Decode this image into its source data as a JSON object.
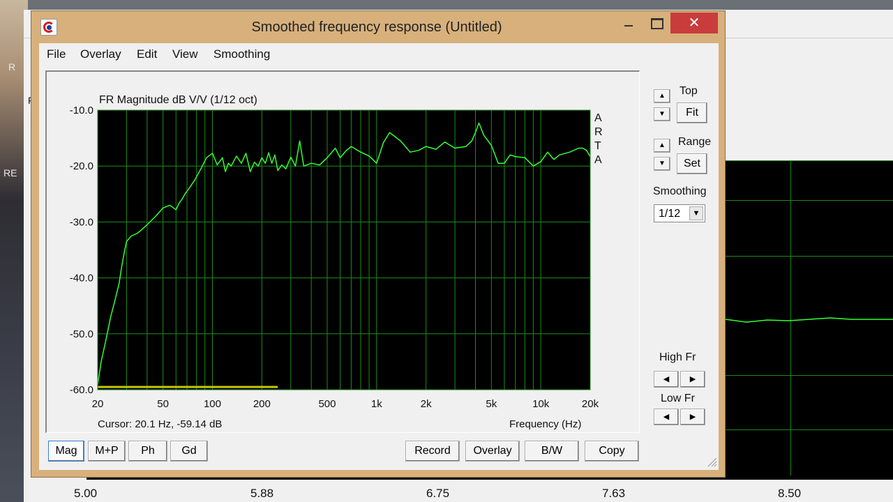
{
  "background": {
    "side_labels": [
      "R",
      "RE",
      "F"
    ],
    "time_axis_ticks": [
      "5.00",
      "5.88",
      "6.75",
      "7.63",
      "8.50"
    ]
  },
  "window": {
    "title": "Smoothed frequency response (Untitled)",
    "close_glyph": "✕",
    "icons": {
      "app": "arta-app-icon",
      "minimize": "minimize-icon",
      "maximize": "maximize-icon",
      "close": "close-icon"
    }
  },
  "menu": [
    "File",
    "Overlay",
    "Edit",
    "View",
    "Smoothing"
  ],
  "plot": {
    "cursor_readout": "Cursor: 20.1 Hz, -59.14 dB",
    "brand_letters": [
      "A",
      "R",
      "T",
      "A"
    ]
  },
  "controls": {
    "top_label": "Top",
    "fit_label": "Fit",
    "range_label": "Range",
    "set_label": "Set",
    "smoothing_label": "Smoothing",
    "smoothing_value": "1/12",
    "high_fr_label": "High Fr",
    "low_fr_label": "Low Fr",
    "up_glyph": "▲",
    "down_glyph": "▼",
    "left_glyph": "◀",
    "right_glyph": "▶",
    "dropdown_glyph": "▼"
  },
  "bottom_buttons": {
    "view_modes": [
      "Mag",
      "M+P",
      "Ph",
      "Gd"
    ],
    "actions": [
      "Record",
      "Overlay",
      "B/W",
      "Copy"
    ],
    "selected": "Mag"
  },
  "chart_data": {
    "type": "line",
    "title": "FR Magnitude dB V/V (1/12 oct)",
    "xlabel": "Frequency (Hz)",
    "ylabel": "",
    "x_scale": "log",
    "xlim": [
      20,
      20000
    ],
    "ylim": [
      -60,
      -10
    ],
    "x_ticks": [
      20,
      50,
      100,
      200,
      500,
      1000,
      2000,
      5000,
      10000,
      20000
    ],
    "x_tick_labels": [
      "20",
      "50",
      "100",
      "200",
      "500",
      "1k",
      "2k",
      "5k",
      "10k",
      "20k"
    ],
    "y_ticks": [
      -10,
      -20,
      -30,
      -40,
      -50,
      -60
    ],
    "y_tick_labels": [
      "-10.0",
      "-20.0",
      "-30.0",
      "-40.0",
      "-50.0",
      "-60.0"
    ],
    "grid": true,
    "colors": {
      "background": "#000000",
      "grid": "#1e8c1e",
      "trace": "#33ff33",
      "marker": "#c8c800"
    },
    "series": [
      {
        "color": "#33ff33",
        "x": [
          20,
          21,
          22.5,
          24,
          25.5,
          27,
          28,
          29,
          30,
          32,
          35,
          40,
          45,
          50,
          55,
          60,
          63,
          65,
          68,
          72,
          78,
          85,
          92,
          100,
          107,
          115,
          120,
          125,
          130,
          140,
          150,
          160,
          170,
          180,
          190,
          200,
          210,
          220,
          230,
          240,
          250,
          265,
          280,
          300,
          320,
          340,
          360,
          400,
          450,
          500,
          560,
          600,
          650,
          700,
          800,
          900,
          1000,
          1100,
          1200,
          1400,
          1600,
          1800,
          2000,
          2300,
          2600,
          3000,
          3500,
          3800,
          4000,
          4200,
          4500,
          5000,
          5500,
          6000,
          6500,
          7000,
          8000,
          9000,
          10000,
          11000,
          12000,
          13000,
          15000,
          17000,
          18000,
          19000,
          20000
        ],
        "y": [
          -59.1,
          -55,
          -51,
          -47,
          -44,
          -41,
          -38,
          -35.5,
          -33.5,
          -32.5,
          -32,
          -30.5,
          -29,
          -27.5,
          -27,
          -27.8,
          -26.5,
          -26,
          -25,
          -24,
          -22.5,
          -20.5,
          -18.5,
          -17.7,
          -19.8,
          -18.5,
          -21,
          -19.5,
          -20,
          -18.2,
          -19.5,
          -17.7,
          -21,
          -19.3,
          -20,
          -18.5,
          -19.5,
          -17.6,
          -19.5,
          -18,
          -20.8,
          -19.8,
          -20.5,
          -18.4,
          -20,
          -15.5,
          -20,
          -19.5,
          -19.8,
          -18.5,
          -16.8,
          -18.5,
          -17.3,
          -16.5,
          -17.5,
          -18.2,
          -19.5,
          -15.8,
          -14,
          -15.5,
          -17.5,
          -17.2,
          -16.5,
          -17,
          -15.7,
          -16.8,
          -16.5,
          -15.5,
          -14,
          -12.3,
          -14.5,
          -16.3,
          -19.5,
          -19.5,
          -18,
          -18.3,
          -18.5,
          -20,
          -19.2,
          -17.5,
          -18.8,
          -18,
          -17.5,
          -16.8,
          -16.8,
          -17.2,
          -18.3
        ]
      }
    ],
    "annotations": [
      {
        "type": "hline_segment",
        "color": "#c8c800",
        "y": -59.5,
        "x_start": 20,
        "x_end": 250
      }
    ]
  }
}
